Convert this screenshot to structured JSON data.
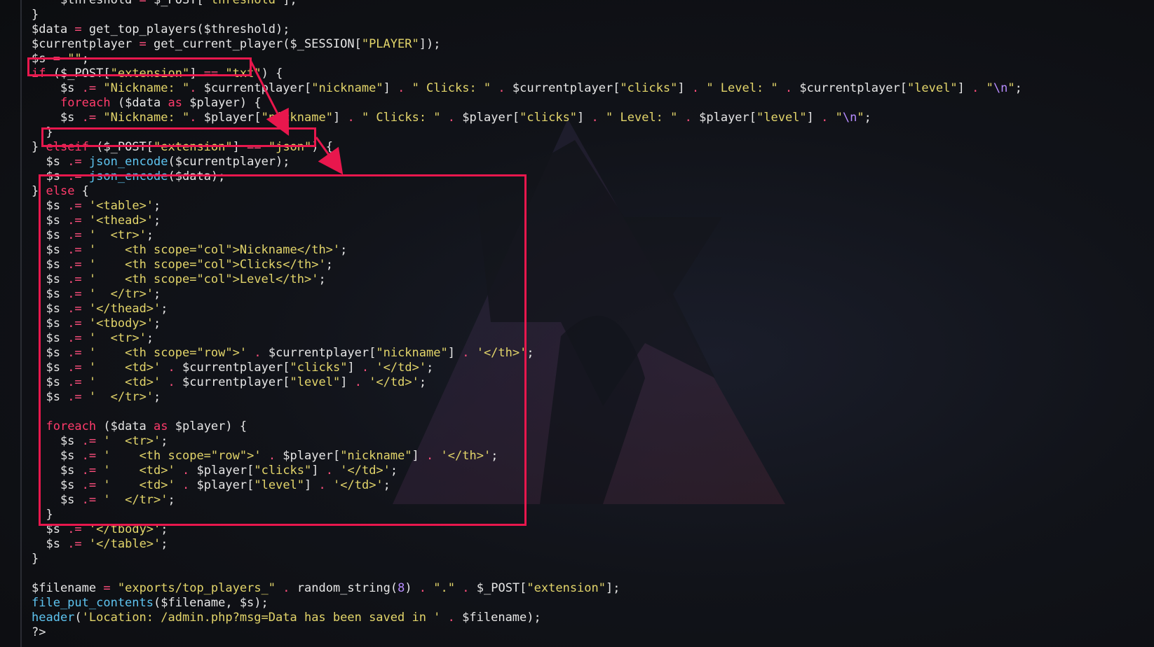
{
  "code_lines": [
    "    $threshold = $_POST[\"threshold\"];",
    "}",
    "$data = get_top_players($threshold);",
    "$currentplayer = get_current_player($_SESSION[\"PLAYER\"]);",
    "$s = \"\";",
    "if ($_POST[\"extension\"] == \"txt\") {",
    "    $s .= \"Nickname: \". $currentplayer[\"nickname\"] . \" Clicks: \" . $currentplayer[\"clicks\"] . \" Level: \" . $currentplayer[\"level\"] . \"\\n\";",
    "    foreach ($data as $player) {",
    "    $s .= \"Nickname: \". $player[\"nickname\"] . \" Clicks: \" . $player[\"clicks\"] . \" Level: \" . $player[\"level\"] . \"\\n\";",
    "  }",
    "} elseif ($_POST[\"extension\"] == \"json\") {",
    "  $s .= json_encode($currentplayer);",
    "  $s .= json_encode($data);",
    "} else {",
    "  $s .= '<table>';",
    "  $s .= '<thead>';",
    "  $s .= '  <tr>';",
    "  $s .= '    <th scope=\"col\">Nickname</th>';",
    "  $s .= '    <th scope=\"col\">Clicks</th>';",
    "  $s .= '    <th scope=\"col\">Level</th>';",
    "  $s .= '  </tr>';",
    "  $s .= '</thead>';",
    "  $s .= '<tbody>';",
    "  $s .= '  <tr>';",
    "  $s .= '    <th scope=\"row\">' . $currentplayer[\"nickname\"] . '</th>';",
    "  $s .= '    <td>' . $currentplayer[\"clicks\"] . '</td>';",
    "  $s .= '    <td>' . $currentplayer[\"level\"] . '</td>';",
    "  $s .= '  </tr>';",
    "",
    "  foreach ($data as $player) {",
    "    $s .= '  <tr>';",
    "    $s .= '    <th scope=\"row\">' . $player[\"nickname\"] . '</th>';",
    "    $s .= '    <td>' . $player[\"clicks\"] . '</td>';",
    "    $s .= '    <td>' . $player[\"level\"] . '</td>';",
    "    $s .= '  </tr>';",
    "  }",
    "  $s .= '</tbody>';",
    "  $s .= '</table>';",
    "}",
    "",
    "$filename = \"exports/top_players_\" . random_string(8) . \".\" . $_POST[\"extension\"];",
    "file_put_contents($filename, $s);",
    "header('Location: /admin.php?msg=Data has been saved in ' . $filename);",
    "?>"
  ],
  "colors": {
    "keyword": "#ff3b6b",
    "string": "#e3d56a",
    "function": "#5ec4f0",
    "operator": "#ff4f7d",
    "number": "#b78cff",
    "highlight": "#e8174d",
    "background": "#0e0f13"
  },
  "annotations": {
    "box_if_txt": "if ($_POST[\"extension\"] == \"txt\")",
    "box_elseif_json": "elseif ($_POST[\"extension\"] == \"json\")",
    "box_else_table": "else"
  },
  "wallpaper_icon": "wolf-logo-icon"
}
